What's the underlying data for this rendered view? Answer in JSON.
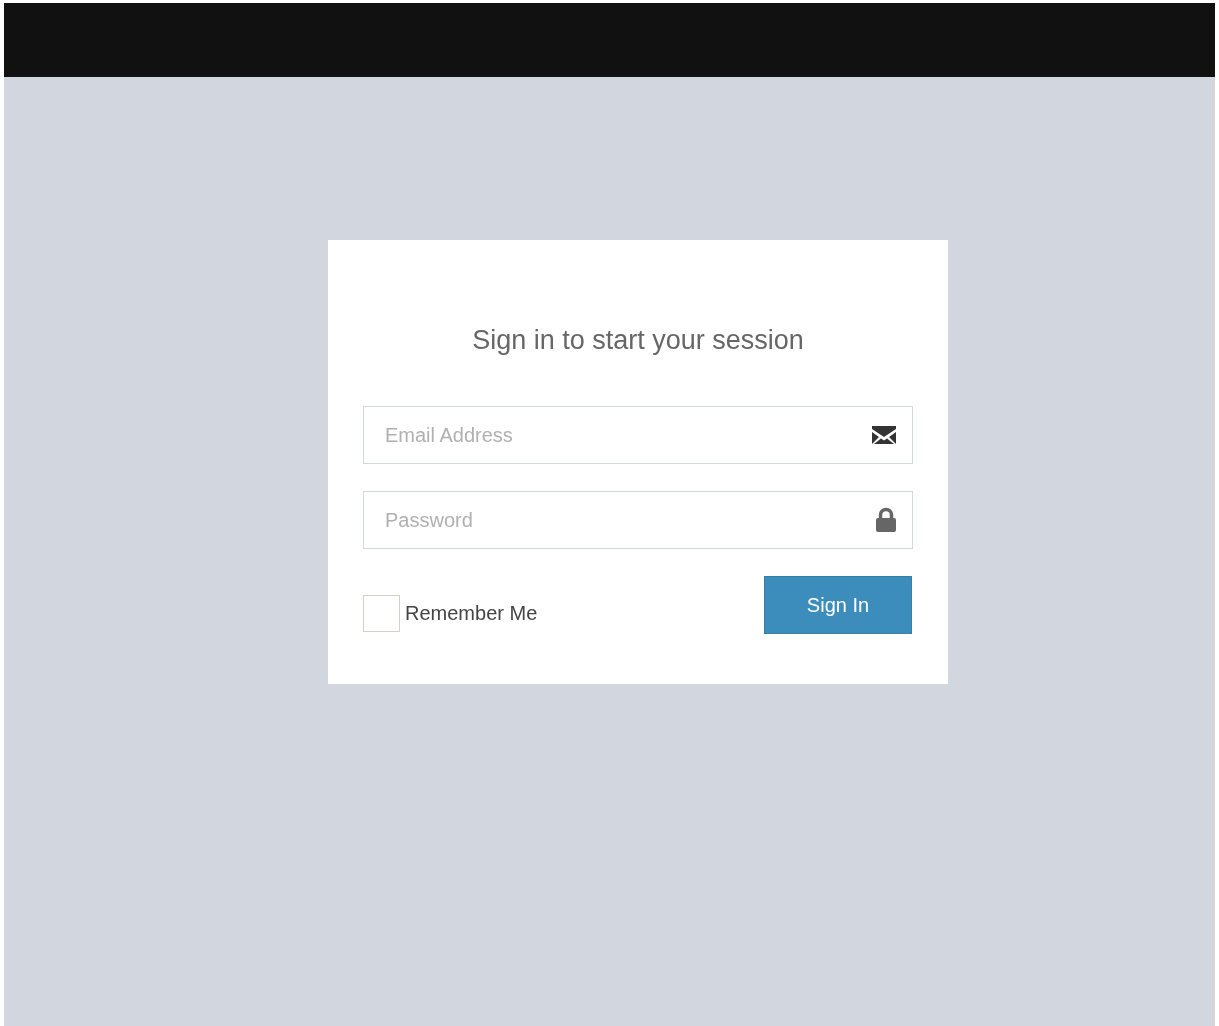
{
  "login": {
    "title": "Sign in to start your session",
    "fields": [
      {
        "kind": "email",
        "placeholder": "Email Address"
      },
      {
        "kind": "password",
        "placeholder": "Password"
      }
    ],
    "remember": {
      "label": "Remember Me",
      "checked": false
    },
    "button": "Sign In"
  }
}
